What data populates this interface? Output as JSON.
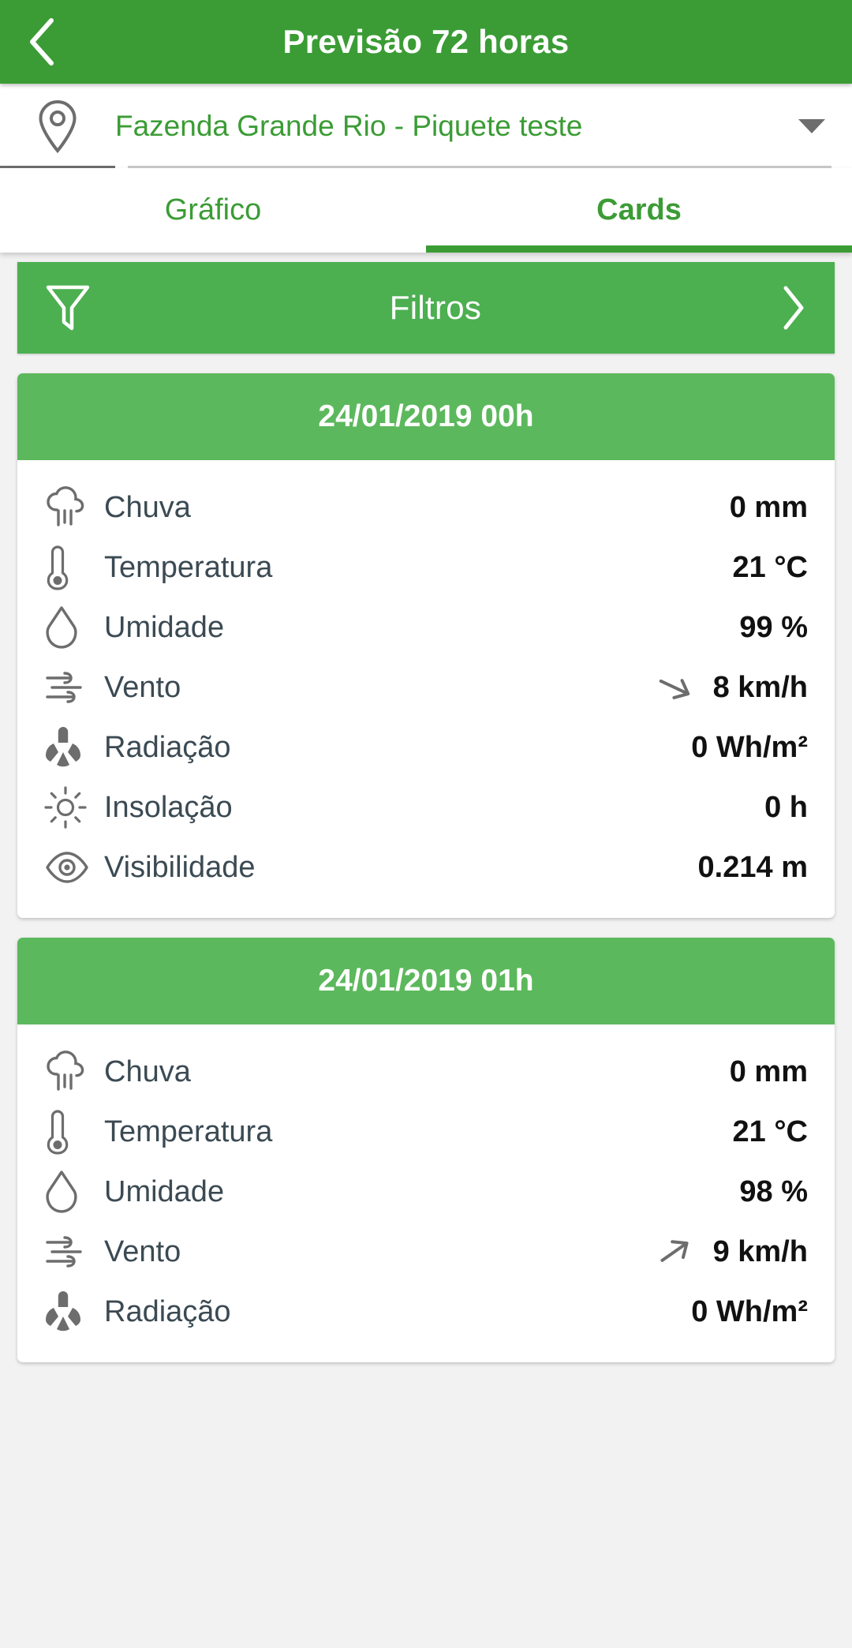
{
  "appbar": {
    "title": "Previsão 72 horas",
    "back_icon": "chevron-left-icon",
    "background_color": "#3b9c35"
  },
  "location": {
    "icon": "map-pin-icon",
    "value": "Fazenda Grande Rio - Piquete teste",
    "dropdown_icon": "caret-down-icon",
    "text_color": "#3b9c35"
  },
  "tabs": {
    "items": [
      {
        "label": "Gráfico",
        "active": false
      },
      {
        "label": "Cards",
        "active": true
      }
    ],
    "accent_color": "#3b9c35"
  },
  "filters": {
    "label": "Filtros",
    "left_icon": "funnel-icon",
    "right_icon": "chevron-right-icon",
    "background_color": "#4caf50"
  },
  "cards": [
    {
      "title": "24/01/2019 00h",
      "rows": [
        {
          "icon": "rain-cloud-icon",
          "label": "Chuva",
          "value": "0 mm",
          "arrow": null
        },
        {
          "icon": "thermometer-icon",
          "label": "Temperatura",
          "value": "21 °C",
          "arrow": null
        },
        {
          "icon": "droplet-icon",
          "label": "Umidade",
          "value": "99 %",
          "arrow": null
        },
        {
          "icon": "wind-icon",
          "label": "Vento",
          "value": "8 km/h",
          "arrow": 115
        },
        {
          "icon": "radiation-icon",
          "label": "Radiação",
          "value": "0 Wh/m²",
          "arrow": null
        },
        {
          "icon": "sun-icon",
          "label": "Insolação",
          "value": "0 h",
          "arrow": null
        },
        {
          "icon": "eye-icon",
          "label": "Visibilidade",
          "value": "0.214 m",
          "arrow": null
        }
      ]
    },
    {
      "title": "24/01/2019 01h",
      "rows": [
        {
          "icon": "rain-cloud-icon",
          "label": "Chuva",
          "value": "0 mm",
          "arrow": null
        },
        {
          "icon": "thermometer-icon",
          "label": "Temperatura",
          "value": "21 °C",
          "arrow": null
        },
        {
          "icon": "droplet-icon",
          "label": "Umidade",
          "value": "98 %",
          "arrow": null
        },
        {
          "icon": "wind-icon",
          "label": "Vento",
          "value": "9 km/h",
          "arrow": 55
        },
        {
          "icon": "radiation-icon",
          "label": "Radiação",
          "value": "0 Wh/m²",
          "arrow": null
        }
      ]
    }
  ]
}
